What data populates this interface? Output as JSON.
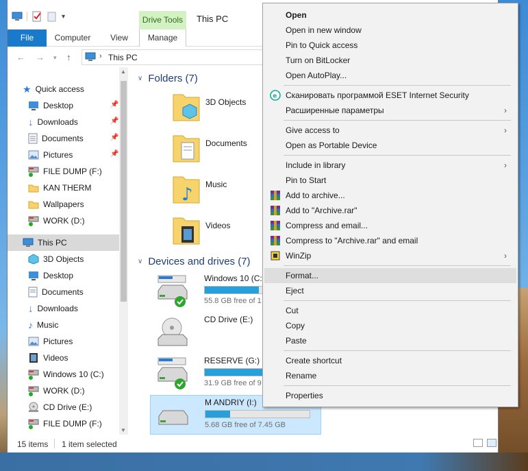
{
  "window": {
    "title": "This PC",
    "contextual_tab_group": "Drive Tools"
  },
  "ribbon_tabs": [
    "File",
    "Computer",
    "View",
    "Manage"
  ],
  "address": {
    "breadcrumb": "This PC"
  },
  "nav_pane": {
    "quick_access_label": "Quick access",
    "quick_access": [
      {
        "label": "Desktop",
        "icon": "desktop-folder-icon",
        "pinned": true
      },
      {
        "label": "Downloads",
        "icon": "downloads-folder-icon",
        "pinned": true
      },
      {
        "label": "Documents",
        "icon": "documents-folder-icon",
        "pinned": true
      },
      {
        "label": "Pictures",
        "icon": "pictures-folder-icon",
        "pinned": true
      },
      {
        "label": "FILE DUMP (F:)",
        "icon": "network-drive-icon",
        "pinned": false
      },
      {
        "label": "KAN THERM",
        "icon": "folder-icon",
        "pinned": false
      },
      {
        "label": "Wallpapers",
        "icon": "folder-icon",
        "pinned": false
      },
      {
        "label": "WORK (D:)",
        "icon": "network-drive-icon",
        "pinned": false
      }
    ],
    "this_pc_label": "This PC",
    "this_pc": [
      {
        "label": "3D Objects",
        "icon": "3d-objects-icon"
      },
      {
        "label": "Desktop",
        "icon": "desktop-folder-icon"
      },
      {
        "label": "Documents",
        "icon": "documents-folder-icon"
      },
      {
        "label": "Downloads",
        "icon": "downloads-folder-icon"
      },
      {
        "label": "Music",
        "icon": "music-folder-icon"
      },
      {
        "label": "Pictures",
        "icon": "pictures-folder-icon"
      },
      {
        "label": "Videos",
        "icon": "videos-folder-icon"
      },
      {
        "label": "Windows 10 (C:)",
        "icon": "network-drive-icon"
      },
      {
        "label": "WORK (D:)",
        "icon": "network-drive-icon"
      },
      {
        "label": "CD Drive (E:)",
        "icon": "cd-drive-icon"
      },
      {
        "label": "FILE DUMP (F:)",
        "icon": "network-drive-icon"
      }
    ]
  },
  "content": {
    "folders_header": "Folders (7)",
    "folders": [
      {
        "label": "3D Objects",
        "icon": "3d-objects-icon"
      },
      {
        "label": "Documents",
        "icon": "documents-folder-icon"
      },
      {
        "label": "Music",
        "icon": "music-folder-icon"
      },
      {
        "label": "Videos",
        "icon": "videos-folder-icon"
      }
    ],
    "drives_header": "Devices and drives (7)",
    "drives": [
      {
        "name": "Windows 10 (C:",
        "free": "55.8 GB free of 1",
        "used_fraction": 0.52,
        "icon": "system-drive-icon"
      },
      {
        "name": "CD Drive (E:)",
        "free": "",
        "used_fraction": null,
        "icon": "cd-drive-icon"
      },
      {
        "name": "RESERVE (G:)",
        "free": "31.9 GB free of 9",
        "used_fraction": 0.65,
        "icon": "system-drive-icon"
      },
      {
        "name": "M    ANDRIY (I:)",
        "free": "5.68 GB free of 7.45 GB",
        "used_fraction": 0.24,
        "icon": "usb-drive-icon",
        "selected": true
      }
    ]
  },
  "status": {
    "item_count": "15 items",
    "selection": "1 item selected"
  },
  "context_menu": {
    "items": [
      {
        "label": "Open",
        "bold": true
      },
      {
        "label": "Open in new window"
      },
      {
        "label": "Pin to Quick access"
      },
      {
        "label": "Turn on BitLocker"
      },
      {
        "label": "Open AutoPlay..."
      },
      {
        "sep": true
      },
      {
        "label": "Сканировать программой ESET Internet Security",
        "icon": "eset-icon"
      },
      {
        "label": "Расширенные параметры",
        "submenu": true
      },
      {
        "sep": true
      },
      {
        "label": "Give access to",
        "submenu": true
      },
      {
        "label": "Open as Portable Device"
      },
      {
        "sep": true
      },
      {
        "label": "Include in library",
        "submenu": true
      },
      {
        "label": "Pin to Start"
      },
      {
        "label": "Add to archive...",
        "icon": "winrar-icon"
      },
      {
        "label": "Add to \"Archive.rar\"",
        "icon": "winrar-icon"
      },
      {
        "label": "Compress and email...",
        "icon": "winrar-icon"
      },
      {
        "label": "Compress to \"Archive.rar\" and email",
        "icon": "winrar-icon"
      },
      {
        "label": "WinZip",
        "icon": "winzip-icon",
        "submenu": true
      },
      {
        "sep": true
      },
      {
        "label": "Format...",
        "hover": true
      },
      {
        "label": "Eject"
      },
      {
        "sep": true
      },
      {
        "label": "Cut"
      },
      {
        "label": "Copy"
      },
      {
        "label": "Paste"
      },
      {
        "sep": true
      },
      {
        "label": "Create shortcut"
      },
      {
        "label": "Rename"
      },
      {
        "sep": true
      },
      {
        "label": "Properties"
      }
    ]
  },
  "colors": {
    "file_tab": "#1979ca",
    "drive_tools": "#d4f1c3",
    "bar_fill": "#26a0da",
    "selection": "#cce8ff",
    "group_header": "#1e3c7a"
  }
}
